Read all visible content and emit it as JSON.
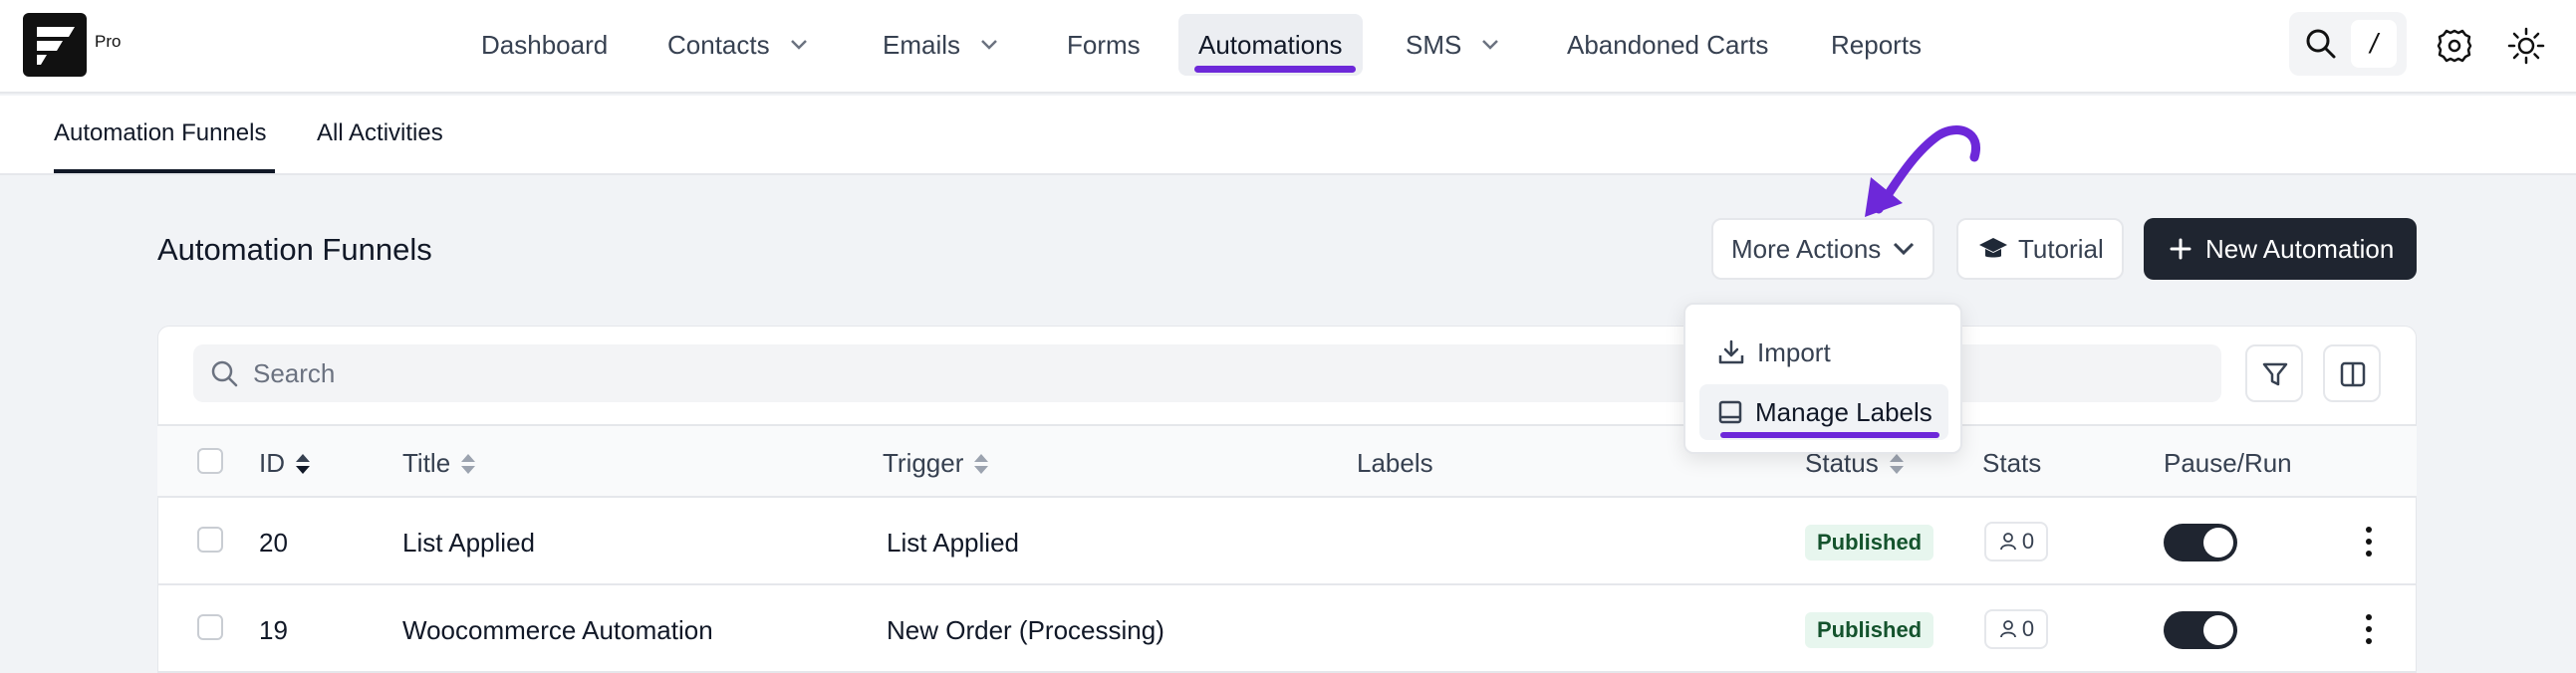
{
  "brand": {
    "logo_icon": "fluentcrm-logo-icon",
    "edition": "Pro"
  },
  "nav": {
    "items": [
      {
        "label": "Dashboard",
        "dropdown": false
      },
      {
        "label": "Contacts",
        "dropdown": true
      },
      {
        "label": "Emails",
        "dropdown": true
      },
      {
        "label": "Forms",
        "dropdown": false
      },
      {
        "label": "Automations",
        "dropdown": false,
        "active": true
      },
      {
        "label": "SMS",
        "dropdown": true
      },
      {
        "label": "Abandoned Carts",
        "dropdown": false
      },
      {
        "label": "Reports",
        "dropdown": false
      }
    ],
    "search_shortcut": "/",
    "icons": [
      "search-icon",
      "settings-icon",
      "theme-toggle-icon"
    ]
  },
  "subtabs": [
    "Automation Funnels",
    "All Activities"
  ],
  "page": {
    "title": "Automation Funnels",
    "more_actions_label": "More Actions",
    "tutorial_label": "Tutorial",
    "new_automation_label": "New Automation"
  },
  "dropdown": {
    "items": [
      {
        "label": "Import",
        "icon": "import-icon"
      },
      {
        "label": "Manage Labels",
        "icon": "label-icon",
        "highlighted": true
      }
    ]
  },
  "search": {
    "placeholder": "Search"
  },
  "table": {
    "columns": [
      "ID",
      "Title",
      "Trigger",
      "Labels",
      "Status",
      "Stats",
      "Pause/Run"
    ],
    "rows": [
      {
        "id": "20",
        "title": "List Applied",
        "trigger": "List Applied",
        "labels": "",
        "status": "Published",
        "stats": "0",
        "running": true
      },
      {
        "id": "19",
        "title": "Woocommerce Automation",
        "trigger": "New Order (Processing)",
        "labels": "",
        "status": "Published",
        "stats": "0",
        "running": true
      }
    ]
  },
  "colors": {
    "accent": "#6d28d9",
    "dark_button": "#1f2530",
    "published_bg": "#e7f6ee"
  }
}
